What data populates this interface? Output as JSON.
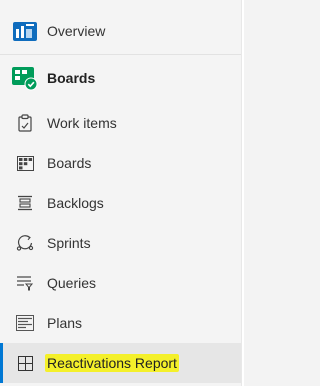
{
  "nav": {
    "overview": {
      "label": "Overview",
      "icon": "overview-icon"
    },
    "boards_section": {
      "label": "Boards",
      "icon": "boards-hub-icon"
    },
    "items": [
      {
        "label": "Work items",
        "icon": "clipboard-icon"
      },
      {
        "label": "Boards",
        "icon": "board-icon"
      },
      {
        "label": "Backlogs",
        "icon": "backlog-icon"
      },
      {
        "label": "Sprints",
        "icon": "sprint-icon"
      },
      {
        "label": "Queries",
        "icon": "query-icon"
      },
      {
        "label": "Plans",
        "icon": "plans-icon"
      },
      {
        "label": "Reactivations Report",
        "icon": "grid-icon"
      }
    ]
  },
  "colors": {
    "accent": "#0078d4",
    "boards_green": "#009c5a",
    "highlight": "#f4f02a"
  }
}
